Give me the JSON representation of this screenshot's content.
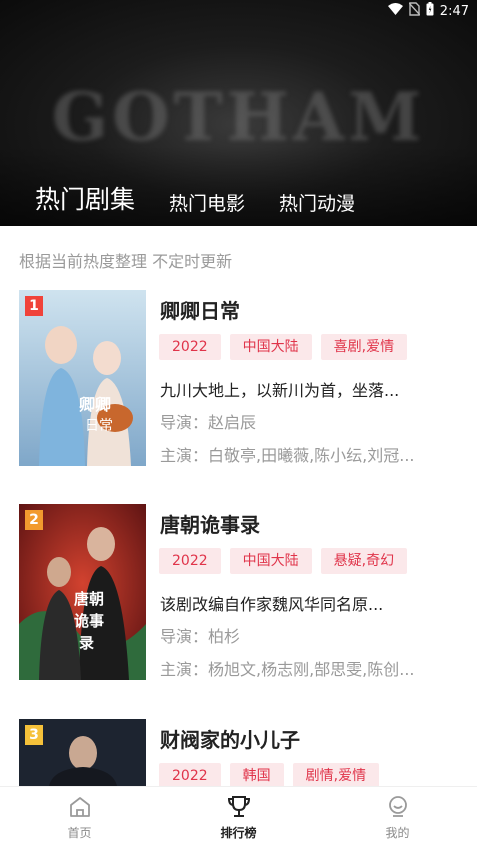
{
  "status_bar": {
    "time": "2:47"
  },
  "banner": {
    "background_text": "GOTHAM"
  },
  "tabs": [
    {
      "label": "热门剧集",
      "active": true
    },
    {
      "label": "热门电影",
      "active": false
    },
    {
      "label": "热门动漫",
      "active": false
    }
  ],
  "subtitle": "根据当前热度整理 不定时更新",
  "items": [
    {
      "rank": "1",
      "rank_color": "#f0433a",
      "title": "卿卿日常",
      "tags": [
        "2022",
        "中国大陆",
        "喜剧,爱情"
      ],
      "desc": "九川大地上，以新川为首，坐落...",
      "director": "导演：赵启辰",
      "cast": "主演：白敬亭,田曦薇,陈小纭,刘冠..."
    },
    {
      "rank": "2",
      "rank_color": "#f29a2e",
      "title": "唐朝诡事录",
      "tags": [
        "2022",
        "中国大陆",
        "悬疑,奇幻"
      ],
      "desc": "该剧改编自作家魏风华同名原...",
      "director": "导演：柏杉",
      "cast": "主演：杨旭文,杨志刚,郜思雯,陈创..."
    },
    {
      "rank": "3",
      "rank_color": "#f5c13a",
      "title": "财阀家的小儿子",
      "tags": [
        "2022",
        "韩国",
        "剧情,爱情"
      ]
    }
  ],
  "bottom_nav": [
    {
      "label": "首页",
      "icon": "home-icon",
      "active": false
    },
    {
      "label": "排行榜",
      "icon": "trophy-icon",
      "active": true
    },
    {
      "label": "我的",
      "icon": "profile-icon",
      "active": false
    }
  ],
  "colors": {
    "accent": "#e0344a",
    "tag_bg": "#fbe8ea"
  }
}
